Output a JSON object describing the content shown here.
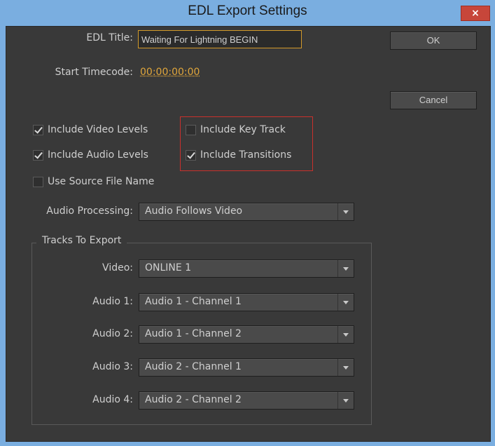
{
  "window": {
    "title": "EDL Export Settings",
    "close_label": "×"
  },
  "form": {
    "edl_title_label": "EDL Title:",
    "edl_title_value": "Waiting For Lightning BEGIN",
    "start_timecode_label": "Start Timecode:",
    "start_timecode_value": "00:00:00:00"
  },
  "buttons": {
    "ok": "OK",
    "cancel": "Cancel"
  },
  "checkboxes": [
    {
      "label": "Include Video Levels",
      "checked": true
    },
    {
      "label": "Include Audio Levels",
      "checked": true
    },
    {
      "label": "Use Source File Name",
      "checked": false
    },
    {
      "label": "Include Key Track",
      "checked": false
    },
    {
      "label": "Include Transitions",
      "checked": true
    }
  ],
  "audio_processing": {
    "label": "Audio Processing:",
    "value": "Audio Follows Video"
  },
  "tracks": {
    "group_label": "Tracks To Export",
    "rows": [
      {
        "label": "Video:",
        "value": "ONLINE 1"
      },
      {
        "label": "Audio 1:",
        "value": "Audio 1 - Channel 1"
      },
      {
        "label": "Audio 2:",
        "value": "Audio 1 - Channel 2"
      },
      {
        "label": "Audio 3:",
        "value": "Audio 2 - Channel 1"
      },
      {
        "label": "Audio 4:",
        "value": "Audio 2 - Channel 2"
      }
    ]
  },
  "colors": {
    "accent_timecode": "#e0a63b",
    "highlight_border": "#c9302c",
    "field_border": "#d39a2a"
  }
}
